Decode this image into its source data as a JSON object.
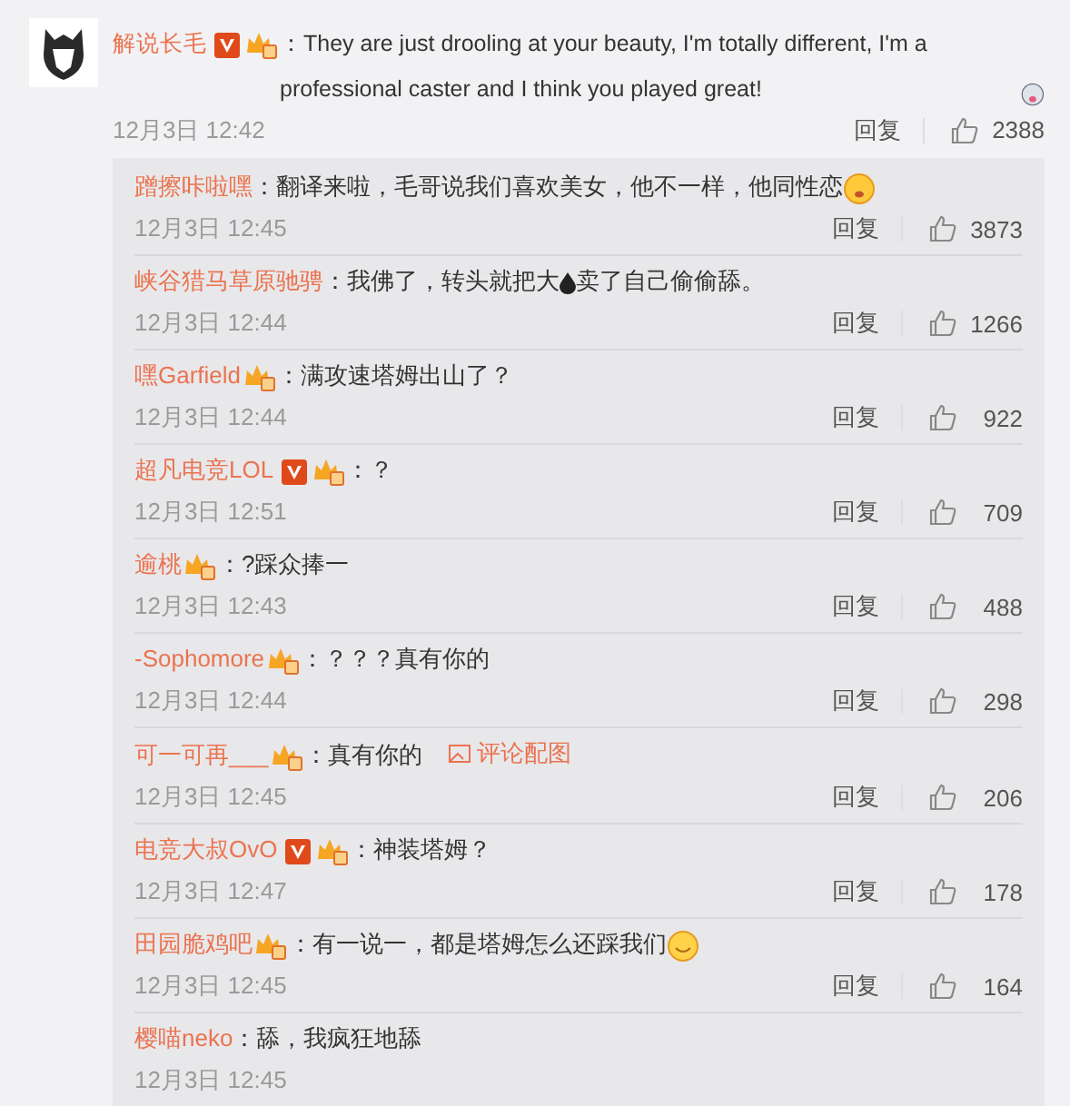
{
  "comment": {
    "author": "解说长毛",
    "verified": true,
    "member": true,
    "segments": [
      {
        "kind": "text",
        "text": "：They are just drooling at your beauty, I'm totally different, I'm a professional caster and I think you played great!"
      },
      {
        "kind": "ghost"
      }
    ],
    "time": "12月3日 12:42",
    "reply": "回复",
    "likes": "2388"
  },
  "replies": [
    {
      "author": "蹭擦咔啦嘿",
      "verified": false,
      "member": false,
      "segments": [
        {
          "kind": "text",
          "text": "：翻译来啦，毛哥说我们喜欢美女，他不一样，他同性恋"
        },
        {
          "kind": "blush"
        }
      ],
      "time": "12月3日 12:45",
      "reply": "回复",
      "likes": "3873"
    },
    {
      "author": "峡谷猎马草原驰骋",
      "verified": false,
      "member": false,
      "segments": [
        {
          "kind": "text",
          "text": "：我佛了，转头就把大"
        },
        {
          "kind": "drop"
        },
        {
          "kind": "text",
          "text": "卖了自己偷偷舔。"
        }
      ],
      "time": "12月3日 12:44",
      "reply": "回复",
      "likes": "1266"
    },
    {
      "author": "嘿Garfield",
      "verified": false,
      "member": true,
      "segments": [
        {
          "kind": "text",
          "text": "：满攻速塔姆出山了？"
        }
      ],
      "time": "12月3日 12:44",
      "reply": "回复",
      "likes": "922"
    },
    {
      "author": "超凡电竞LOL",
      "verified": true,
      "member": true,
      "segments": [
        {
          "kind": "text",
          "text": "：？"
        }
      ],
      "time": "12月3日 12:51",
      "reply": "回复",
      "likes": "709"
    },
    {
      "author": "逾桃",
      "verified": false,
      "member": true,
      "segments": [
        {
          "kind": "text",
          "text": "：?踩众捧一"
        }
      ],
      "time": "12月3日 12:43",
      "reply": "回复",
      "likes": "488"
    },
    {
      "author": "-Sophomore",
      "verified": false,
      "member": true,
      "segments": [
        {
          "kind": "text",
          "text": "：？？？真有你的"
        }
      ],
      "time": "12月3日 12:44",
      "reply": "回复",
      "likes": "298"
    },
    {
      "author": "可一可再___",
      "verified": false,
      "member": true,
      "segments": [
        {
          "kind": "text",
          "text": "：真有你的"
        },
        {
          "kind": "image-link",
          "text": "评论配图"
        }
      ],
      "time": "12月3日 12:45",
      "reply": "回复",
      "likes": "206"
    },
    {
      "author": "电竞大叔OvO",
      "verified": true,
      "member": true,
      "segments": [
        {
          "kind": "text",
          "text": "：神装塔姆？"
        }
      ],
      "time": "12月3日 12:47",
      "reply": "回复",
      "likes": "178"
    },
    {
      "author": "田园脆鸡吧",
      "verified": false,
      "member": true,
      "segments": [
        {
          "kind": "text",
          "text": "：有一说一，都是塔姆怎么还踩我们"
        },
        {
          "kind": "smile"
        }
      ],
      "time": "12月3日 12:45",
      "reply": "回复",
      "likes": "164"
    },
    {
      "author": "樱喵neko",
      "verified": false,
      "member": false,
      "segments": [
        {
          "kind": "text",
          "text": "：舔，我疯狂地舔"
        }
      ],
      "time": "12月3日 12:45"
    }
  ]
}
